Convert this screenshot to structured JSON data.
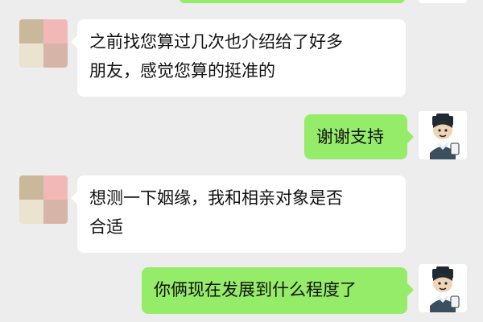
{
  "messages": [
    {
      "side": "in",
      "avatar": "blurred-avatar",
      "text": "之前找您算过几次也介绍给了好多\n朋友，感觉您算的挺准的"
    },
    {
      "side": "out",
      "avatar": "cartoon-scholar-avatar",
      "text": "谢谢支持"
    },
    {
      "side": "in",
      "avatar": "blurred-avatar",
      "text": "想测一下姻缘，我和相亲对象是否\n合适"
    },
    {
      "side": "out",
      "avatar": "cartoon-scholar-avatar",
      "text": "你俩现在发展到什么程度了"
    }
  ],
  "colors": {
    "background": "#ededed",
    "incoming_bubble": "#ffffff",
    "outgoing_bubble": "#95ec69",
    "text": "#111111"
  }
}
